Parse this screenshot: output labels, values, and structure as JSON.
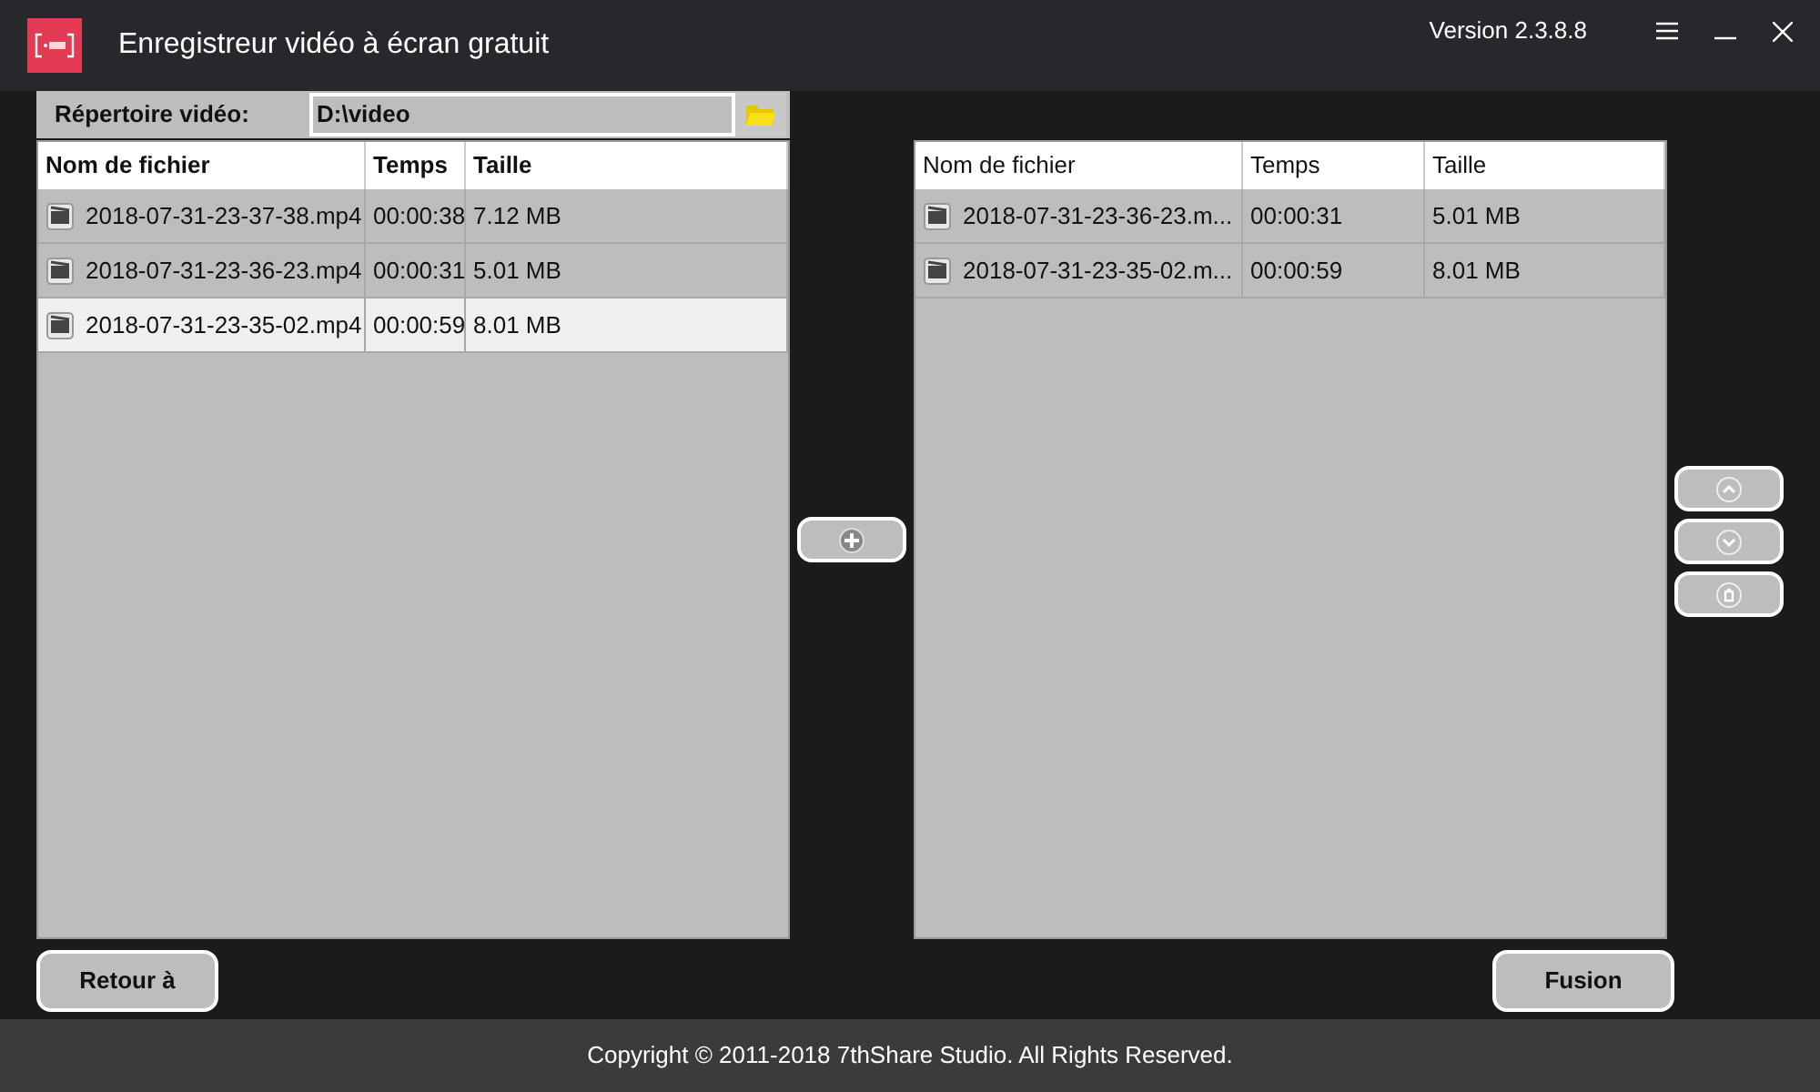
{
  "window": {
    "title": "Enregistreur vidéo à écran gratuit",
    "version": "Version 2.3.8.8"
  },
  "directory": {
    "label": "Répertoire vidéo:",
    "value": "D:\\video"
  },
  "source_table": {
    "columns": [
      "Nom de fichier",
      "Temps",
      "Taille"
    ],
    "rows": [
      {
        "cells": [
          "2018-07-31-23-37-38.mp4",
          "00:00:38",
          "7.12 MB"
        ],
        "selected": false
      },
      {
        "cells": [
          "2018-07-31-23-36-23.mp4",
          "00:00:31",
          "5.01 MB"
        ],
        "selected": false
      },
      {
        "cells": [
          "2018-07-31-23-35-02.mp4",
          "00:00:59",
          "8.01 MB"
        ],
        "selected": true
      }
    ]
  },
  "merge_table": {
    "columns": [
      "Nom de fichier",
      "Temps",
      "Taille"
    ],
    "rows": [
      {
        "cells": [
          "2018-07-31-23-36-23.m...",
          "00:00:31",
          "5.01 MB"
        ],
        "selected": false
      },
      {
        "cells": [
          "2018-07-31-23-35-02.m...",
          "00:00:59",
          "8.01 MB"
        ],
        "selected": false
      }
    ]
  },
  "buttons": {
    "back": "Retour à",
    "merge": "Fusion"
  },
  "status_bar": "Copyright © 2011-2018 7thShare Studio. All Rights Reserved."
}
